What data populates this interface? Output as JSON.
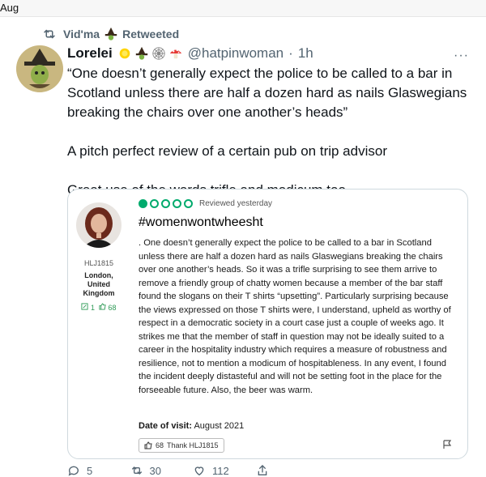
{
  "top_strip": {
    "text": "Aug"
  },
  "retweet": {
    "user": "Vid'ma",
    "label": "Retweeted"
  },
  "tweet": {
    "author_name": "Lorelei",
    "handle": "@hatpinwoman",
    "separator": "·",
    "time": "1h",
    "more": "···",
    "lines": [
      "“One doesn’t generally expect the police to be called to a bar in Scotland unless there are half a dozen hard as nails Glaswegians breaking the chairs over one another’s heads”",
      "A pitch perfect review of a certain pub on trip advisor",
      "Great use of the words trifle and modicum,too"
    ]
  },
  "review_card": {
    "reviewer_handle": "HLJ1815",
    "location_lines": [
      "London,",
      "United",
      "Kingdom"
    ],
    "contributions": "1",
    "helpful_votes": "68",
    "rating_out_of_5": 1,
    "reviewed_text": "Reviewed yesterday",
    "title": "#womenwontwheesht",
    "body": ". One doesn’t generally expect the police to be called to a bar in Scotland unless there are half a dozen hard as nails Glaswegians breaking the chairs over one another’s heads. So it was a trifle surprising to see them arrive to remove a friendly group of chatty women because a member of the bar staff found the slogans on their T shirts “upsetting”. Particularly surprising because the views expressed on those T shirts were, I understand, upheld as worthy of respect in a democratic society in a court case just a couple of weeks ago. It strikes me that the member of staff in question may not be ideally suited to a career in the hospitality industry which requires a measure of robustness and resilience, not to mention a modicum of hospitableness. In any event, I found the incident deeply distasteful and will not be setting foot in the place for the forseeable future. Also, the beer was warm.",
    "date_label": "Date of visit:",
    "date_value": "August 2021",
    "thank_count": "68",
    "thank_label": "Thank HLJ1815",
    "accent_color": "#00aa6c"
  },
  "actions": {
    "replies": "5",
    "retweets": "30",
    "likes": "112"
  }
}
